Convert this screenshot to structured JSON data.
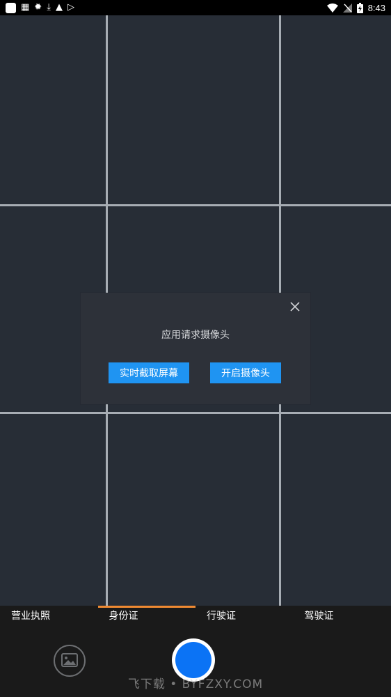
{
  "status_bar": {
    "time": "8:43",
    "left_icons": [
      "app-icon",
      "news-icon",
      "fire-icon",
      "download-icon",
      "a-icon",
      "play-store-icon"
    ],
    "right_icons": [
      "wifi-icon",
      "signal-icon",
      "battery-icon"
    ]
  },
  "dialog": {
    "message": "应用请求摄像头",
    "screen_capture_button": "实时截取屏幕",
    "open_camera_button": "开启摄像头"
  },
  "tabs": [
    {
      "label": "营业执照",
      "active": false
    },
    {
      "label": "身份证",
      "active": true
    },
    {
      "label": "行驶证",
      "active": false
    },
    {
      "label": "驾驶证",
      "active": false
    }
  ],
  "watermark": "飞下载 • BYFZXY.COM",
  "colors": {
    "accent": "#1f94f2",
    "active_tab": "#f08a32",
    "shutter": "#0b73f5"
  }
}
